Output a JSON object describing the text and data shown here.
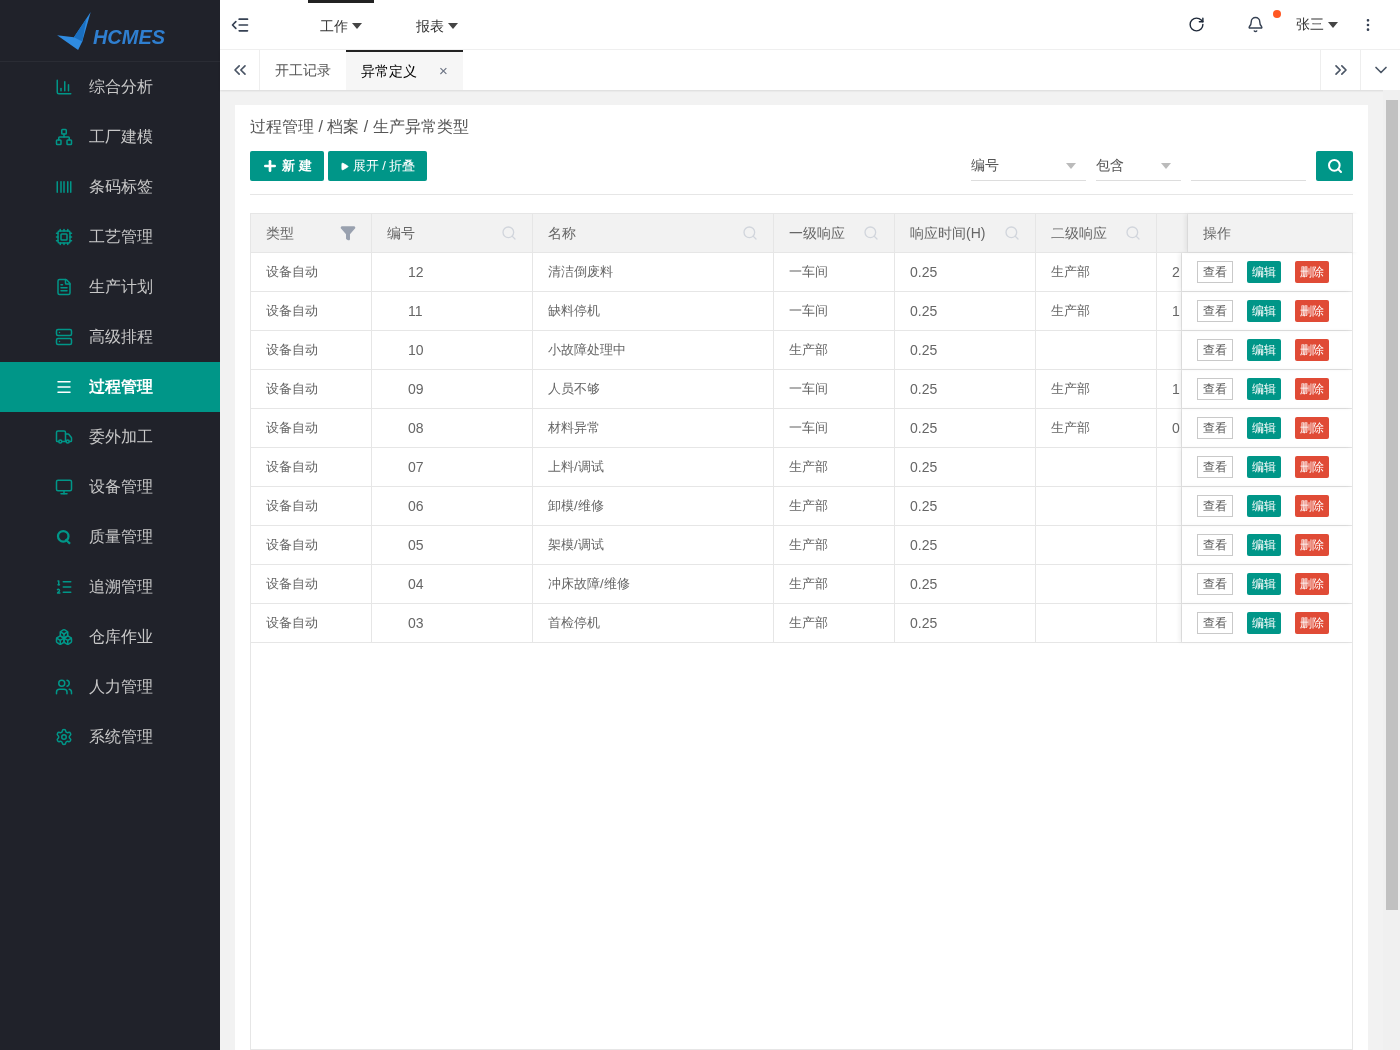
{
  "logo": {
    "text": "HCMES"
  },
  "sidebar": {
    "items": [
      {
        "label": "综合分析",
        "selected": false
      },
      {
        "label": "工厂建模",
        "selected": false
      },
      {
        "label": "条码标签",
        "selected": false
      },
      {
        "label": "工艺管理",
        "selected": false
      },
      {
        "label": "生产计划",
        "selected": false
      },
      {
        "label": "高级排程",
        "selected": false
      },
      {
        "label": "过程管理",
        "selected": true
      },
      {
        "label": "委外加工",
        "selected": false
      },
      {
        "label": "设备管理",
        "selected": false
      },
      {
        "label": "质量管理",
        "selected": false
      },
      {
        "label": "追溯管理",
        "selected": false
      },
      {
        "label": "仓库作业",
        "selected": false
      },
      {
        "label": "人力管理",
        "selected": false
      },
      {
        "label": "系统管理",
        "selected": false
      }
    ]
  },
  "top_nav": [
    {
      "label": "工作",
      "selected": true
    },
    {
      "label": "报表",
      "selected": false
    }
  ],
  "user": {
    "name": "张三",
    "notification_dot": true
  },
  "tabs": [
    {
      "label": "开工记录",
      "selected": false
    },
    {
      "label": "异常定义",
      "selected": true,
      "close": "×"
    }
  ],
  "breadcrumb": "过程管理 / 档案 / 生产异常类型",
  "toolbar": {
    "new_button": "新 建",
    "expand_button": "展开 / 折叠"
  },
  "filter": {
    "field": "编号",
    "operator": "包含"
  },
  "table": {
    "columns": [
      {
        "label": "类型",
        "kind": "filter"
      },
      {
        "label": "编号",
        "kind": "search"
      },
      {
        "label": "名称",
        "kind": "search"
      },
      {
        "label": "一级响应",
        "kind": "search"
      },
      {
        "label": "响应时间(H)",
        "kind": "search"
      },
      {
        "label": "二级响应",
        "kind": "search"
      },
      {
        "kind": "cut"
      },
      {
        "label": "操作",
        "kind": "none"
      }
    ],
    "rows": [
      {
        "cells": [
          "设备自动",
          "12",
          "清洁倒废料",
          "一车间",
          "0.25",
          "生产部",
          "2"
        ],
        "actions": [
          "查看",
          "编辑",
          "删除"
        ]
      },
      {
        "cells": [
          "设备自动",
          "11",
          "缺料停机",
          "一车间",
          "0.25",
          "生产部",
          "1"
        ],
        "actions": [
          "查看",
          "编辑",
          "删除"
        ]
      },
      {
        "cells": [
          "设备自动",
          "10",
          "小故障处理中",
          "生产部",
          "0.25",
          null,
          null
        ],
        "actions": [
          "查看",
          "编辑",
          "删除"
        ]
      },
      {
        "cells": [
          "设备自动",
          "09",
          "人员不够",
          "一车间",
          "0.25",
          "生产部",
          "1"
        ],
        "actions": [
          "查看",
          "编辑",
          "删除"
        ]
      },
      {
        "cells": [
          "设备自动",
          "08",
          "材料异常",
          "一车间",
          "0.25",
          "生产部",
          "0"
        ],
        "actions": [
          "查看",
          "编辑",
          "删除"
        ]
      },
      {
        "cells": [
          "设备自动",
          "07",
          "上料/调试",
          "生产部",
          "0.25",
          null,
          null
        ],
        "actions": [
          "查看",
          "编辑",
          "删除"
        ]
      },
      {
        "cells": [
          "设备自动",
          "06",
          "卸模/维修",
          "生产部",
          "0.25",
          null,
          null
        ],
        "actions": [
          "查看",
          "编辑",
          "删除"
        ]
      },
      {
        "cells": [
          "设备自动",
          "05",
          "架模/调试",
          "生产部",
          "0.25",
          null,
          null
        ],
        "actions": [
          "查看",
          "编辑",
          "删除"
        ]
      },
      {
        "cells": [
          "设备自动",
          "04",
          "冲床故障/维修",
          "生产部",
          "0.25",
          null,
          null
        ],
        "actions": [
          "查看",
          "编辑",
          "删除"
        ]
      },
      {
        "cells": [
          "设备自动",
          "03",
          "首检停机",
          "生产部",
          "0.25",
          null,
          null
        ],
        "actions": [
          "查看",
          "编辑",
          "删除"
        ]
      }
    ]
  }
}
